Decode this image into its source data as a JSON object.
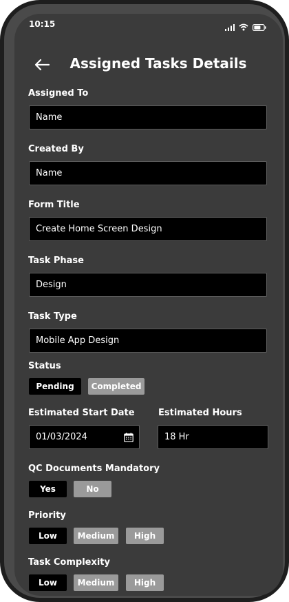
{
  "status_bar": {
    "time": "10:15"
  },
  "header": {
    "title": "Assigned Tasks Details"
  },
  "fields": {
    "assigned_to": {
      "label": "Assigned To",
      "value": "Name"
    },
    "created_by": {
      "label": "Created By",
      "value": "Name"
    },
    "form_title": {
      "label": "Form Title",
      "value": "Create Home Screen Design"
    },
    "task_phase": {
      "label": "Task Phase",
      "value": "Design"
    },
    "task_type": {
      "label": "Task Type",
      "value": "Mobile App Design"
    },
    "start_date": {
      "label": "Estimated Start Date",
      "value": "01/03/2024"
    },
    "hours": {
      "label": "Estimated Hours",
      "value": "18 Hr"
    }
  },
  "status": {
    "label": "Status",
    "options": [
      "Pending",
      "Completed"
    ],
    "selected": "Pending"
  },
  "qc": {
    "label": "QC Documents Mandatory",
    "options": [
      "Yes",
      "No"
    ],
    "selected": "Yes"
  },
  "priority": {
    "label": "Priority",
    "options": [
      "Low",
      "Medium",
      "High"
    ],
    "selected": "Low"
  },
  "complexity": {
    "label": "Task Complexity",
    "options": [
      "Low",
      "Medium",
      "High"
    ],
    "selected": "Low"
  },
  "colors": {
    "screen_bg": "#3b3b3b",
    "field_bg": "#000000",
    "chip_selected": "#000000",
    "chip_unselected": "#9a9a9a"
  },
  "icons": [
    "back-arrow-icon",
    "signal-icon",
    "wifi-icon",
    "battery-icon",
    "calendar-icon"
  ]
}
